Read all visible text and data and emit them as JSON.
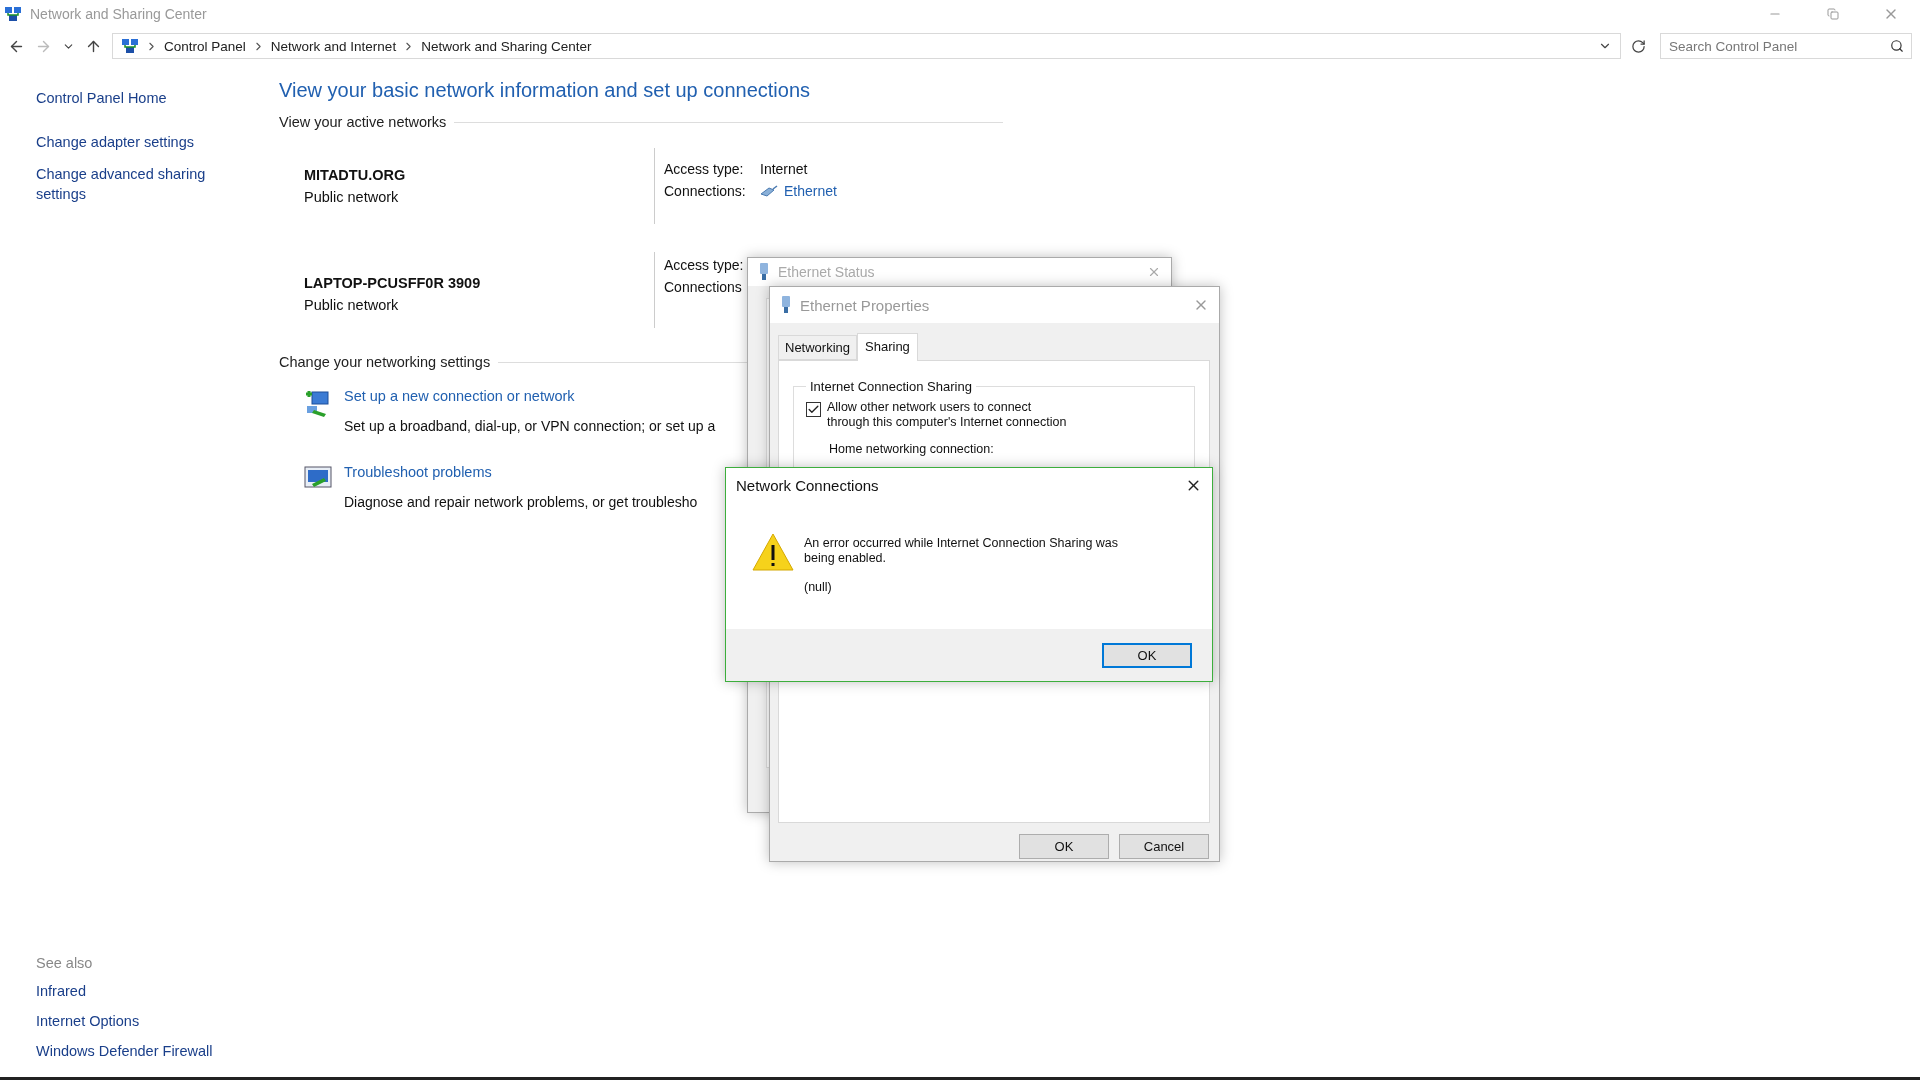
{
  "window": {
    "title": "Network and Sharing Center"
  },
  "address_bar": {
    "breadcrumbs": [
      "Control Panel",
      "Network and Internet",
      "Network and Sharing Center"
    ]
  },
  "search": {
    "placeholder": "Search Control Panel"
  },
  "sidebar": {
    "links": [
      "Control Panel Home",
      "Change adapter settings",
      "Change advanced sharing settings"
    ],
    "see_also": {
      "title": "See also",
      "links": [
        "Infrared",
        "Internet Options",
        "Windows Defender Firewall"
      ]
    }
  },
  "main": {
    "heading": "View your basic network information and set up connections",
    "active_networks": {
      "title": "View your active networks",
      "networks": [
        {
          "name": "MITADTU.ORG",
          "type": "Public network",
          "details": [
            {
              "label": "Access type:",
              "value": "Internet",
              "kind": "text"
            },
            {
              "label": "Connections:",
              "value": "Ethernet",
              "kind": "link"
            }
          ]
        },
        {
          "name": "LAPTOP-PCUSFF0R 3909",
          "type": "Public network",
          "details": [
            {
              "label": "Access type:"
            },
            {
              "label": "Connections"
            }
          ]
        }
      ]
    },
    "settings": {
      "title": "Change your networking settings",
      "items": [
        {
          "kind": "setup",
          "link": "Set up a new connection or network",
          "description": "Set up a broadband, dial-up, or VPN connection; or set up a"
        },
        {
          "kind": "troubleshoot",
          "link": "Troubleshoot problems",
          "description": "Diagnose and repair network problems, or get troublesho"
        }
      ]
    }
  },
  "dialogs": {
    "status": {
      "title": "Ethernet Status"
    },
    "properties": {
      "title": "Ethernet Properties",
      "tabs": [
        {
          "label": "Networking",
          "selected": false
        },
        {
          "label": "Sharing",
          "selected": true
        }
      ],
      "sharing": {
        "title": "Internet Connection Sharing",
        "checkbox": {
          "label": "Allow other network users to connect through this computer's Internet connection",
          "checked": true
        },
        "home_label": "Home networking connection:"
      },
      "buttons": [
        "OK",
        "Cancel"
      ]
    },
    "error": {
      "title": "Network Connections",
      "message": "An error occurred while Internet Connection Sharing was being enabled.",
      "detail": "(null)",
      "button": "OK"
    }
  }
}
